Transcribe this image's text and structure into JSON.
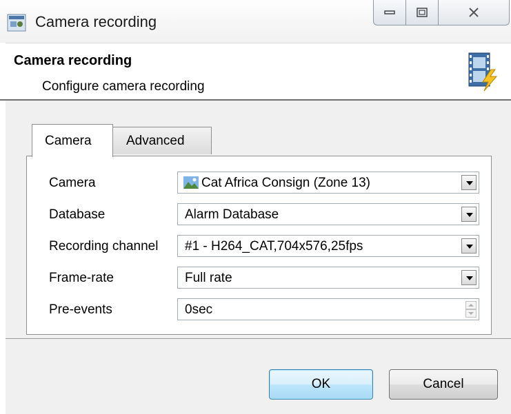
{
  "window": {
    "title": "Camera recording"
  },
  "header": {
    "title": "Camera recording",
    "subtitle": "Configure camera recording",
    "icon": "film-lightning-icon"
  },
  "tabs": [
    {
      "label": "Camera",
      "selected": true
    },
    {
      "label": "Advanced",
      "selected": false
    }
  ],
  "fields": {
    "camera": {
      "label": "Camera",
      "value": "Cat Africa Consign (Zone 13)",
      "icon": "camera-landscape-icon"
    },
    "database": {
      "label": "Database",
      "value": "Alarm Database"
    },
    "recording_channel": {
      "label": "Recording channel",
      "value": "#1 - H264_CAT,704x576,25fps"
    },
    "frame_rate": {
      "label": "Frame-rate",
      "value": "Full rate"
    },
    "pre_events": {
      "label": "Pre-events",
      "value": "0sec"
    }
  },
  "buttons": {
    "ok": "OK",
    "cancel": "Cancel"
  },
  "colors": {
    "ok_border": "#3c7fb1",
    "panel_bg": "#f0f0f0"
  }
}
